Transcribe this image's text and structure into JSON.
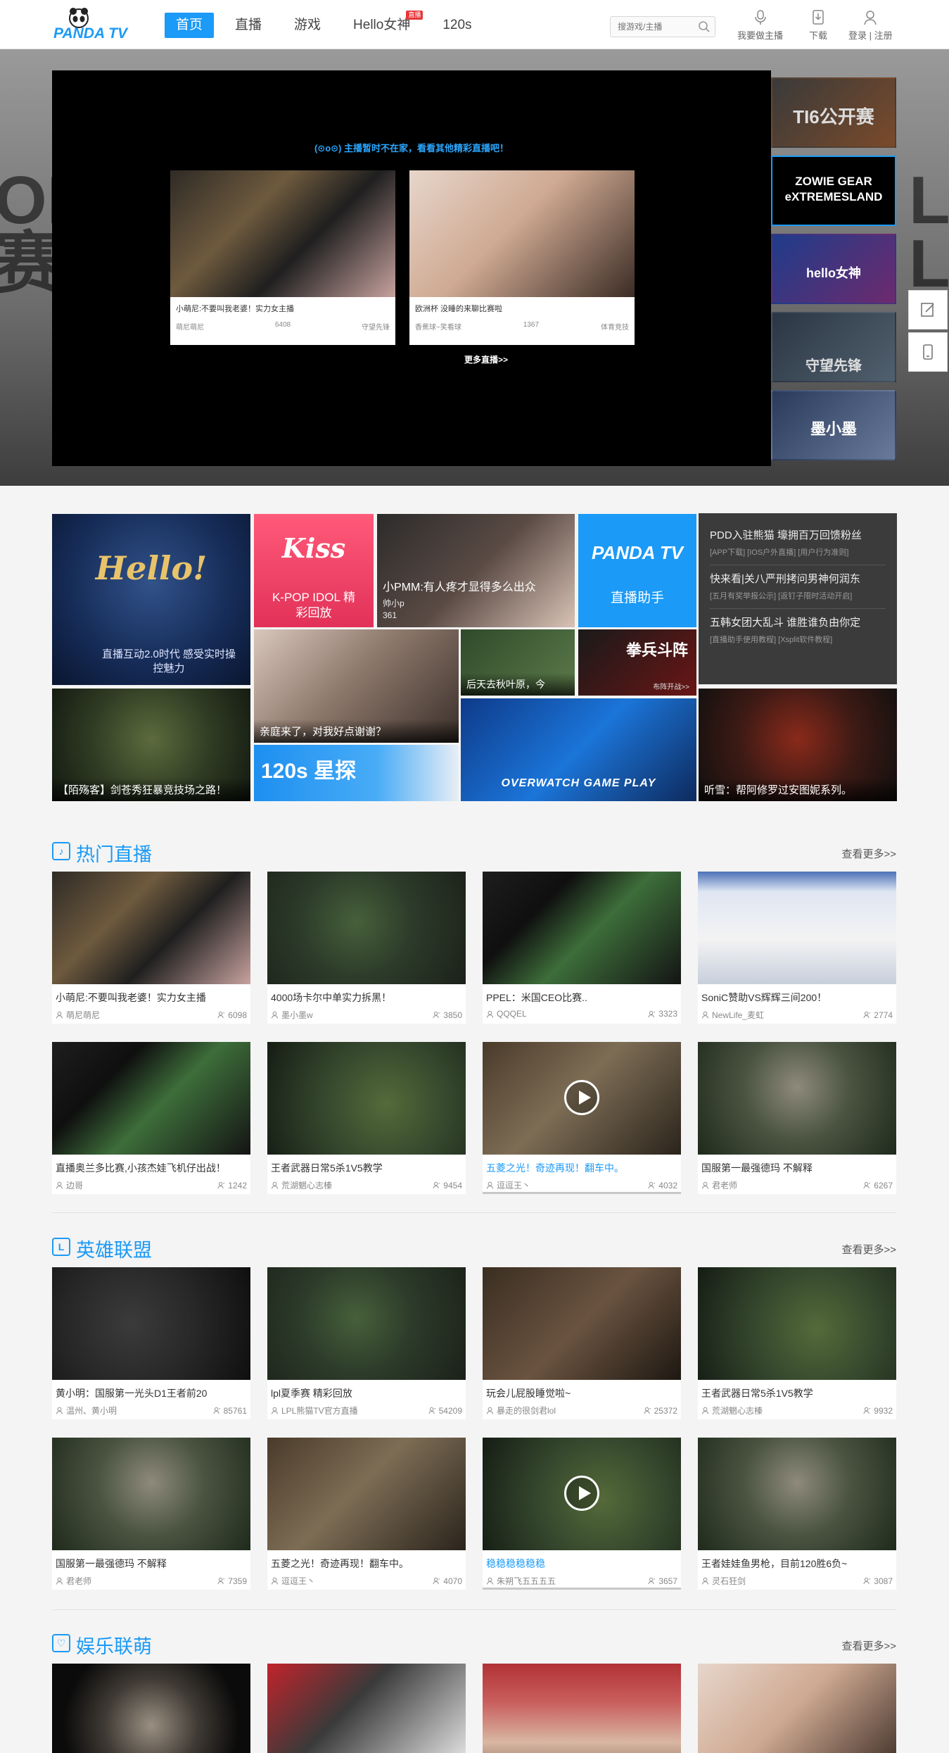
{
  "header": {
    "logo_text": "PANDA TV",
    "nav": [
      {
        "label": "首页",
        "active": true
      },
      {
        "label": "直播"
      },
      {
        "label": "游戏"
      },
      {
        "label": "Hello女神",
        "badge": "直播"
      },
      {
        "label": "120s"
      }
    ],
    "search_placeholder": "搜游戏/主播",
    "buttons": {
      "broadcast": "我要做主播",
      "download": "下载",
      "login": "登录 | 注册"
    }
  },
  "hero": {
    "notice": "(⊙o⊙) 主播暂时不在家，看看其他精彩直播吧！",
    "offline_cards": [
      {
        "title": "小萌尼:不要叫我老婆！实力女主播",
        "streamer": "萌尼萌尼",
        "viewers": "6408",
        "category": "守望先锋"
      },
      {
        "title": "欧洲杯 没睡的来聊比赛啦",
        "streamer": "香蕉球~笑看球",
        "viewers": "1367",
        "category": "体育竞技"
      }
    ],
    "more_live": "更多直播>>",
    "side_thumbs": [
      {
        "label": "TI6公开赛"
      },
      {
        "label": "ZOWIE GEAR eXTREMESLAND",
        "active": true
      },
      {
        "label": "hello女神"
      },
      {
        "label": "守望先锋"
      },
      {
        "label": "墨小墨"
      }
    ],
    "deco_left": "OF\n赛",
    "deco_right": "LL\nL"
  },
  "banners": {
    "hello_goddess": "直播互动2.0时代 感受实时操控魅力",
    "kiss_label": "K-POP IDOL 精彩回放",
    "pmm_title": "小PMM:有人疼才显得多么出众",
    "pmm_streamer": "帅小p",
    "pmm_viewers": "361",
    "panda_helper": "直播助手",
    "girl_caption": "亲庭来了，对我好点谢谢？",
    "autumn_caption": "后天去秋叶原，今",
    "fight_label": "拳兵斗阵",
    "fight_sub": "布阵开战>>",
    "lol_caption": "【陌殇客】剑苍秀狂暴竞技场之路！",
    "s120_label": "120s 星探",
    "ow_label": "OVERWATCH GAME PLAY",
    "asura_caption": "听雪：帮阿修罗过安图妮系列。"
  },
  "news": [
    {
      "title": "PDD入驻熊猫 壕拥百万回馈粉丝",
      "tags": "[APP下载] [IOS户外直播] [用户行为准则]"
    },
    {
      "title": "快来看|关八严刑拷问男神何润东",
      "tags": "[五月有奖举报公示] [返钉子限时活动开启]"
    },
    {
      "title": "五韩女团大乱斗 谁胜谁负由你定",
      "tags": "[直播助手使用教程] [Xsplit软件教程]"
    }
  ],
  "sections": [
    {
      "title": "热门直播",
      "icon": "hot-live-icon",
      "more": "查看更多>>",
      "cards": [
        {
          "title": "小萌尼:不要叫我老婆！实力女主播",
          "streamer": "萌尼萌尼",
          "viewers": "6098",
          "thumb": "t-ow"
        },
        {
          "title": "4000场卡尔中单实力拆黑！",
          "streamer": "墨小墨w",
          "viewers": "3850",
          "thumb": "t-lol"
        },
        {
          "title": "PPEL：米国CEO比赛..",
          "streamer": "QQQEL",
          "viewers": "3323",
          "thumb": "t-ppl"
        },
        {
          "title": "SoniC赞助VS辉辉三间200！",
          "streamer": "NewLife_麦虹",
          "viewers": "2774",
          "thumb": "t-desk"
        },
        {
          "title": "直播奥兰多比赛,小孩杰娃飞机仔出战！",
          "streamer": "边哥",
          "viewers": "1242",
          "thumb": "t-ppl"
        },
        {
          "title": "王者武器日常5杀1V5教学",
          "streamer": "荒湖魍心志榛",
          "viewers": "9454",
          "thumb": "t-lol2"
        },
        {
          "title": "五菱之光！奇迹再现！翻车中。",
          "streamer": "逗逗王丶",
          "viewers": "4032",
          "thumb": "t-game",
          "highlight": true,
          "play": true
        },
        {
          "title": "国服第一最强德玛 不解释",
          "streamer": "君老师",
          "viewers": "6267",
          "thumb": "t-lol3"
        }
      ]
    },
    {
      "title": "英雄联盟",
      "icon": "lol-icon",
      "more": "查看更多>>",
      "cards": [
        {
          "title": "黄小明：国服第一光头D1王者前20",
          "streamer": "温州、黄小明",
          "viewers": "85761",
          "thumb": "t-lol4"
        },
        {
          "title": "lpl夏季赛 精彩回放",
          "streamer": "LPL熊猫TV官方直播",
          "viewers": "54209",
          "thumb": "t-lol"
        },
        {
          "title": "玩会儿屁股睡觉啦~",
          "streamer": "暴走的很剑君lol",
          "viewers": "25372",
          "thumb": "t-dark"
        },
        {
          "title": "王者武器日常5杀1V5教学",
          "streamer": "荒湖魍心志榛",
          "viewers": "9932",
          "thumb": "t-lol2"
        },
        {
          "title": "国服第一最强德玛 不解释",
          "streamer": "君老师",
          "viewers": "7359",
          "thumb": "t-lol3"
        },
        {
          "title": "五菱之光！奇迹再现！翻车中。",
          "streamer": "逗逗王丶",
          "viewers": "4070",
          "thumb": "t-game"
        },
        {
          "title": "稳稳稳稳稳稳",
          "streamer": "朱朔飞五五五五",
          "viewers": "3657",
          "thumb": "t-lol2",
          "highlight": true,
          "play": true
        },
        {
          "title": "王者娃娃鱼男枪，目前120胜6负~",
          "streamer": "灵石狂剑",
          "viewers": "3087",
          "thumb": "t-lol3"
        }
      ]
    },
    {
      "title": "娱乐联萌",
      "icon": "ent-icon",
      "more": "查看更多>>",
      "cards": [
        {
          "title": "",
          "streamer": "",
          "viewers": "",
          "thumb": "t-wheel"
        },
        {
          "title": "",
          "streamer": "",
          "viewers": "",
          "thumb": "t-pc"
        },
        {
          "title": "",
          "streamer": "",
          "viewers": "",
          "thumb": "t-stage"
        },
        {
          "title": "",
          "streamer": "",
          "viewers": "",
          "thumb": "t-girl"
        }
      ]
    }
  ],
  "colors": {
    "accent": "#1b9af7",
    "badge": "#e5383b",
    "news_bg": "#3b3b3b"
  }
}
